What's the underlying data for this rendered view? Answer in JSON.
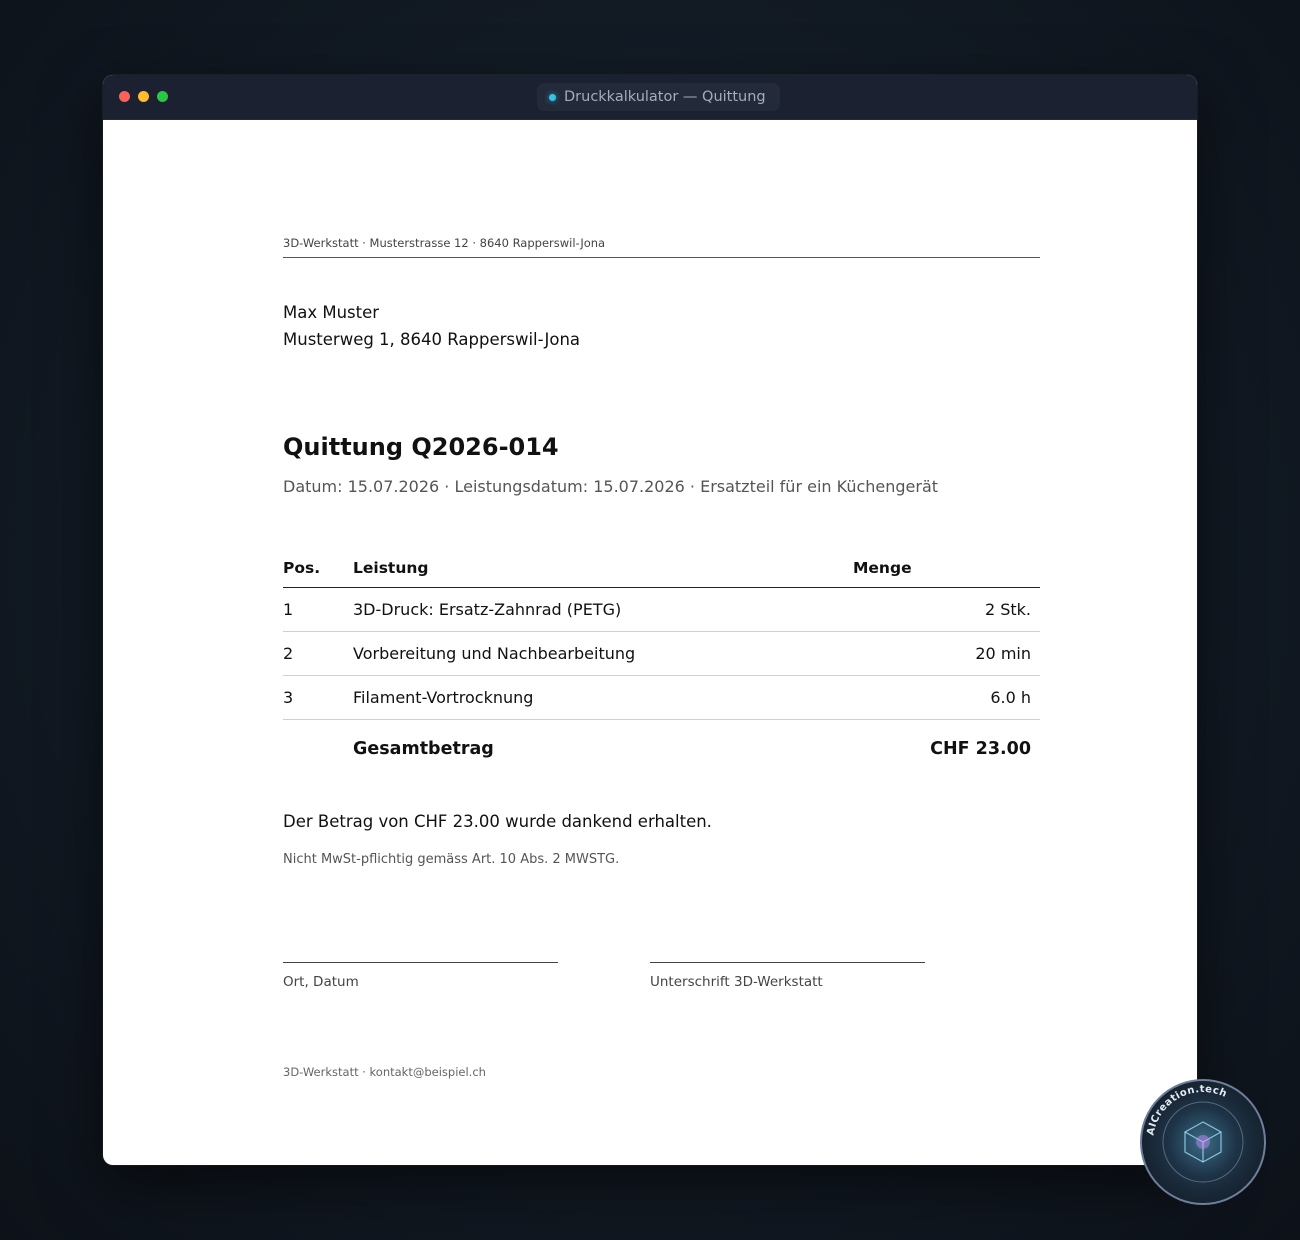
{
  "window": {
    "title": "Druckkalkulator — Quittung"
  },
  "doc": {
    "sender_line": "3D-Werkstatt · Musterstrasse 12 · 8640 Rapperswil-Jona",
    "recipient": {
      "name": "Max Muster",
      "address": "Musterweg 1, 8640 Rapperswil-Jona"
    },
    "title": "Quittung Q2026-014",
    "meta": "Datum: 15.07.2026 · Leistungsdatum: 15.07.2026 · Ersatzteil für ein Küchengerät",
    "table": {
      "headers": [
        "Pos.",
        "Leistung",
        "Menge"
      ],
      "rows": [
        {
          "pos": "1",
          "service": "3D-Druck: Ersatz-Zahnrad (PETG)",
          "qty": "2 Stk."
        },
        {
          "pos": "2",
          "service": "Vorbereitung und Nachbearbeitung",
          "qty": "20 min"
        },
        {
          "pos": "3",
          "service": "Filament-Vortrocknung",
          "qty": "6.0 h"
        }
      ],
      "total_label": "Gesamtbetrag",
      "total_value": "CHF 23.00"
    },
    "thanks": "Der Betrag von CHF 23.00 wurde dankend erhalten.",
    "vat_note": "Nicht MwSt-pflichtig gemäss Art. 10 Abs. 2 MWSTG.",
    "signatures": {
      "left_label": "Ort, Datum",
      "right_label": "Unterschrift 3D-Werkstatt"
    },
    "footer": "3D-Werkstatt · kontakt@beispiel.ch"
  },
  "watermark": {
    "text": "AICreation.tech"
  },
  "colors": {
    "accent_dot": "#2fc6e8",
    "titlebar": "#1b2130"
  }
}
